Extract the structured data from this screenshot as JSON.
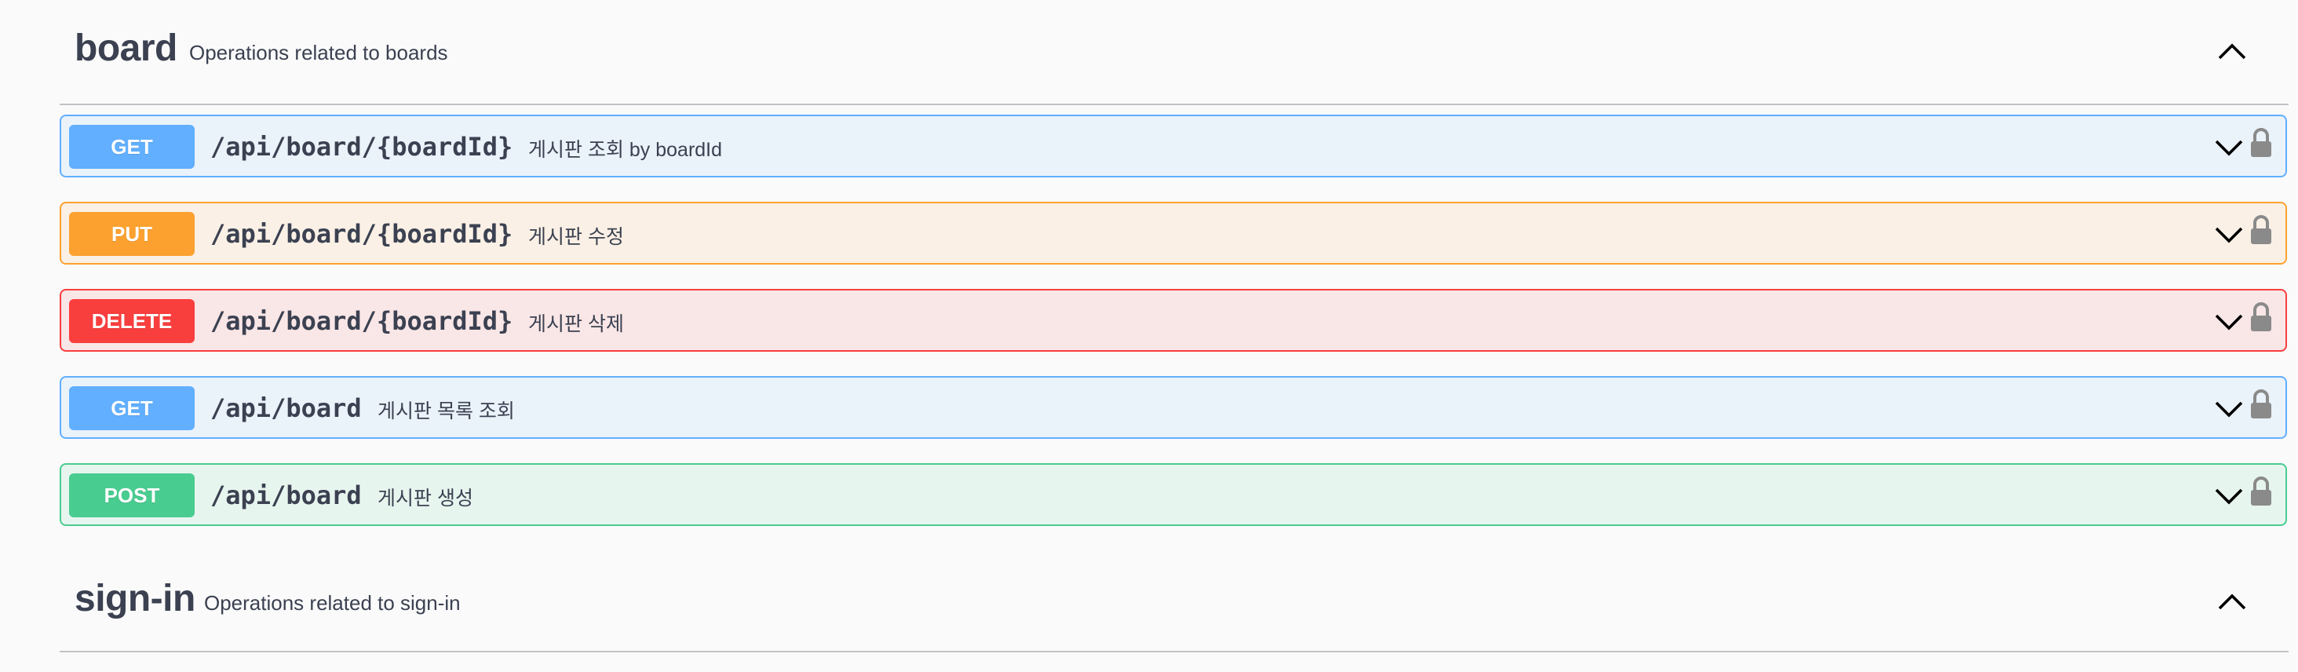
{
  "tags": [
    {
      "name": "board",
      "description": "Operations related to boards"
    },
    {
      "name": "sign-in",
      "description": "Operations related to sign-in"
    }
  ],
  "operations": [
    {
      "method": "GET",
      "path": "/api/board/{boardId}",
      "summary": "게시판 조회 by boardId"
    },
    {
      "method": "PUT",
      "path": "/api/board/{boardId}",
      "summary": "게시판 수정"
    },
    {
      "method": "DELETE",
      "path": "/api/board/{boardId}",
      "summary": "게시판 삭제"
    },
    {
      "method": "GET",
      "path": "/api/board",
      "summary": "게시판 목록 조회"
    },
    {
      "method": "POST",
      "path": "/api/board",
      "summary": "게시판 생성"
    }
  ],
  "colors": {
    "get": "#61affe",
    "put": "#fca130",
    "delete": "#f93e3e",
    "post": "#49cc90",
    "text": "#3b4151",
    "lock": "#8a8a8a"
  },
  "icons": {
    "collapse": "chevron-up-icon",
    "expand": "chevron-down-icon",
    "auth": "lock-icon"
  }
}
